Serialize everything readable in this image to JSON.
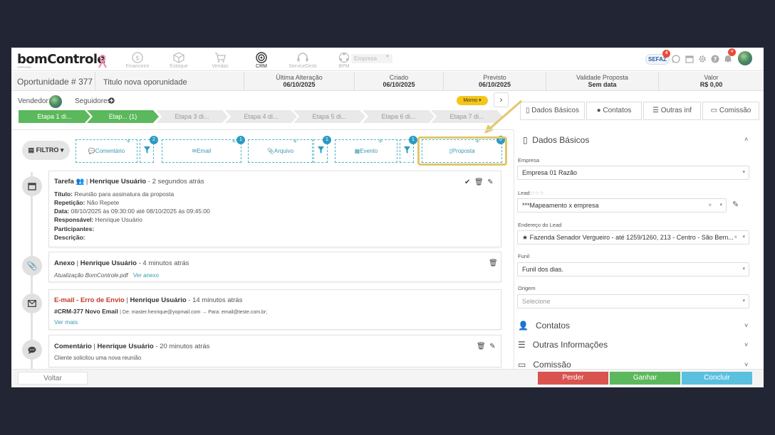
{
  "brand": {
    "logo": "bomControle",
    "logo_sub": "ERP/CRM"
  },
  "modules": [
    {
      "label": "Financeiro",
      "icon": "dollar-icon",
      "active": false
    },
    {
      "label": "Estoque",
      "icon": "box-icon",
      "active": false
    },
    {
      "label": "Vendas",
      "icon": "cart-icon",
      "active": false
    },
    {
      "label": "CRM",
      "icon": "target-icon",
      "active": true
    },
    {
      "label": "ServiceDesk",
      "icon": "headset-icon",
      "active": false
    },
    {
      "label": "BPM",
      "icon": "network-icon",
      "active": false
    }
  ],
  "company_select": {
    "value": "Empresa"
  },
  "top_right": {
    "sefaz": "SEFAZ",
    "sefaz_badge": "4",
    "bell_badge": "4"
  },
  "info": {
    "opportunity": "Oportunidade # 377",
    "title": "Titulo nova oporunidade",
    "last_change_label": "Última Alteração",
    "last_change": "06/10/2025",
    "created_label": "Criado",
    "created": "06/10/2025",
    "expected_label": "Previsto",
    "expected": "06/10/2025",
    "validity_label": "Validade Proposta",
    "validity": "Sem data",
    "value_label": "Valor",
    "value": "R$ 0,00"
  },
  "people": {
    "seller_label": "Vendedor:",
    "followers_label": "Seguidores:",
    "temperature": "Morno"
  },
  "stages": [
    {
      "label": "Etapa 1 di...",
      "done": true
    },
    {
      "label": "Etap... (1)",
      "done": true
    },
    {
      "label": "Etapa 3 di...",
      "done": false
    },
    {
      "label": "Etapa 4 di...",
      "done": false
    },
    {
      "label": "Etapa 5 di...",
      "done": false
    },
    {
      "label": "Etapa 6 di...",
      "done": false
    },
    {
      "label": "Etapa 7 di...",
      "done": false
    }
  ],
  "right_tabs": [
    {
      "label": "Dados Básicos",
      "icon": "document-icon"
    },
    {
      "label": "Contatos",
      "icon": "user-icon"
    },
    {
      "label": "Outras inf",
      "icon": "list-icon"
    },
    {
      "label": "Comissão",
      "icon": "money-icon"
    }
  ],
  "filter": {
    "label": "FILTRO"
  },
  "add_items": [
    {
      "label": "Comentário",
      "badge": "2"
    },
    {
      "label": "Email",
      "badge": "1"
    },
    {
      "label": "Arquivo",
      "badge": "1"
    },
    {
      "label": "Evento",
      "badge": "1"
    },
    {
      "label": "Proposta",
      "badge": "0"
    }
  ],
  "timeline": {
    "task": {
      "type": "Tarefa",
      "user": "Henrique Usuário",
      "time": "- 2 segundos atrás",
      "fields": [
        {
          "label": "Título:",
          "value": "Reunião para assinatura da proposta"
        },
        {
          "label": "Repetição:",
          "value": "Não Repete"
        },
        {
          "label": "Data:",
          "value": "08/10/2025 às 09:30:00 até 08/10/2025 às 09:45:00"
        },
        {
          "label": "Responsável:",
          "value": "Henrique Usuário"
        },
        {
          "label": "Participantes:",
          "value": ""
        },
        {
          "label": "Descrição:",
          "value": ""
        }
      ]
    },
    "attachment": {
      "type": "Anexo",
      "user": "Henrique Usuário",
      "time": "- 4 minutos atrás",
      "file": "Atualização BomControle.pdf",
      "link": "Ver anexo"
    },
    "email": {
      "type": "E-mail - Erro de Envio",
      "user": "Henrique Usuário",
      "time": "- 14 minutos atrás",
      "subject": "#CRM-377 Novo Email",
      "meta": "| De: master.henrique@yopmail.com → Para: email@teste.com.br;",
      "more": "Ver mais"
    },
    "comment": {
      "type": "Comentário",
      "user": "Henrique Usuário",
      "time": "- 20 minutos atrás",
      "text": "Cliente solicitou uma nova reunião"
    }
  },
  "basic_data": {
    "title": "Dados Básicos",
    "empresa_label": "Empresa",
    "empresa": "Empresa 01 Razão",
    "lead_label": "Lead",
    "lead": "***Mapeamento x empresa",
    "address_label": "Endereço do Lead",
    "address": "Fazenda Senador Vergueiro - até 1259/1260, 213 - Centro - São Bern...",
    "funnel_label": "Funil",
    "funnel": "Funil dos dias.",
    "origin_label": "Origem",
    "origin_placeholder": "Selecione"
  },
  "sections": [
    {
      "label": "Contatos",
      "icon": "user-icon"
    },
    {
      "label": "Outras Informações",
      "icon": "list-icon"
    },
    {
      "label": "Comissão",
      "icon": "money-icon"
    }
  ],
  "actions": {
    "back": "Voltar",
    "lose": "Perder",
    "win": "Ganhar",
    "finish": "Concluir"
  },
  "colors": {
    "done_stage": "#5cb85c",
    "lose": "#d9534f",
    "win": "#5cb85c",
    "finish": "#5bc0de",
    "highlight": "#e3c66c",
    "error_text": "#c0392b"
  }
}
